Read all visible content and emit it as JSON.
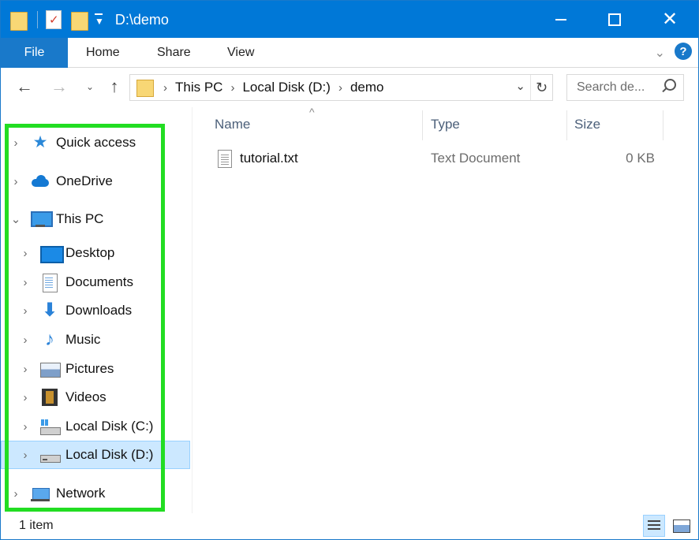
{
  "window": {
    "title": "D:\\demo"
  },
  "ribbon": {
    "tabs": [
      "File",
      "Home",
      "Share",
      "View"
    ]
  },
  "address": {
    "crumbs": [
      "This PC",
      "Local Disk (D:)",
      "demo"
    ]
  },
  "search": {
    "placeholder": "Search de..."
  },
  "sidebar": {
    "items": [
      {
        "label": "Quick access",
        "icon": "star-icon"
      },
      {
        "label": "OneDrive",
        "icon": "cloud-icon"
      },
      {
        "label": "This PC",
        "icon": "computer-icon",
        "expanded": true
      },
      {
        "label": "Desktop",
        "icon": "desktop-icon"
      },
      {
        "label": "Documents",
        "icon": "documents-icon"
      },
      {
        "label": "Downloads",
        "icon": "downloads-icon"
      },
      {
        "label": "Music",
        "icon": "music-icon"
      },
      {
        "label": "Pictures",
        "icon": "pictures-icon"
      },
      {
        "label": "Videos",
        "icon": "videos-icon"
      },
      {
        "label": "Local Disk (C:)",
        "icon": "drive-c-icon"
      },
      {
        "label": "Local Disk (D:)",
        "icon": "drive-d-icon",
        "selected": true
      },
      {
        "label": "Network",
        "icon": "network-icon"
      }
    ]
  },
  "columns": {
    "name": "Name",
    "type": "Type",
    "size": "Size"
  },
  "files": [
    {
      "name": "tutorial.txt",
      "type": "Text Document",
      "size": "0 KB"
    }
  ],
  "status": {
    "count": "1 item"
  },
  "colors": {
    "accent": "#0078d7",
    "selection": "#cce8ff",
    "highlight_outline": "#22dd22"
  }
}
